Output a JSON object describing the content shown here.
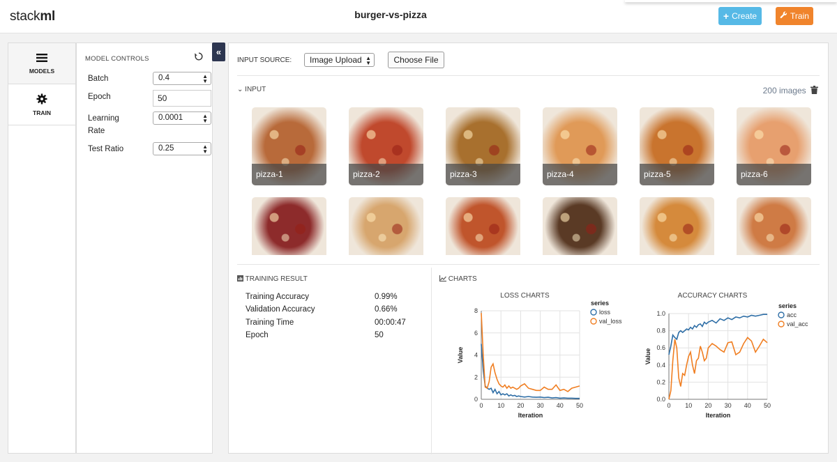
{
  "app": {
    "logo_plain": "stack",
    "logo_bold": "ml",
    "project_title": "burger-vs-pizza"
  },
  "header": {
    "create_label": "Create",
    "train_label": "Train"
  },
  "nav": {
    "items": [
      {
        "label": "MODELS"
      },
      {
        "label": "TRAIN"
      }
    ]
  },
  "controls": {
    "title": "MODEL CONTROLS",
    "batch": {
      "label": "Batch",
      "value": "0.4"
    },
    "epoch": {
      "label": "Epoch",
      "value": "50"
    },
    "learning_rate": {
      "label_1": "Learning",
      "label_2": "Rate",
      "value": "0.0001"
    },
    "test_ratio": {
      "label": "Test Ratio",
      "value": "0.25"
    }
  },
  "input": {
    "source_label": "INPUT SOURCE:",
    "source_value": "Image Upload",
    "choose_file": "Choose File",
    "section_label": "INPUT",
    "count": "200 images",
    "images": [
      {
        "caption": "pizza-1",
        "color": "#b86a3a"
      },
      {
        "caption": "pizza-2",
        "color": "#c0492d"
      },
      {
        "caption": "pizza-3",
        "color": "#a8702e"
      },
      {
        "caption": "pizza-4",
        "color": "#e09a58"
      },
      {
        "caption": "pizza-5",
        "color": "#c9742e"
      },
      {
        "caption": "pizza-6",
        "color": "#e7a06f"
      },
      {
        "caption": "",
        "color": "#8d2b2b"
      },
      {
        "caption": "",
        "color": "#d7a66e"
      },
      {
        "caption": "",
        "color": "#c0552c"
      },
      {
        "caption": "",
        "color": "#5a3a25"
      },
      {
        "caption": "",
        "color": "#d58a3c"
      },
      {
        "caption": "",
        "color": "#cf7b45"
      }
    ]
  },
  "results": {
    "title": "TRAINING RESULT",
    "rows": [
      {
        "label": "Training Accuracy",
        "value": "0.99%"
      },
      {
        "label": "Validation Accuracy",
        "value": "0.66%"
      },
      {
        "label": "Training Time",
        "value": "00:00:47"
      },
      {
        "label": "Epoch",
        "value": "50"
      }
    ]
  },
  "charts_title": "CHARTS",
  "chart_data": [
    {
      "type": "line",
      "title": "LOSS CHARTS",
      "xlabel": "Iteration",
      "ylabel": "Value",
      "xlim": [
        0,
        50
      ],
      "ylim": [
        0,
        8
      ],
      "x_ticks": [
        0,
        10,
        20,
        30,
        40,
        50
      ],
      "y_ticks": [
        0,
        2,
        4,
        6,
        8
      ],
      "grid": true,
      "legend_title": "series",
      "legend_position": "top-right",
      "series": [
        {
          "name": "loss",
          "color": "#2e6ea6",
          "x": [
            0,
            1,
            2,
            3,
            4,
            5,
            6,
            7,
            8,
            9,
            10,
            11,
            12,
            13,
            14,
            15,
            16,
            17,
            18,
            19,
            20,
            22,
            24,
            26,
            28,
            30,
            32,
            34,
            36,
            38,
            40,
            42,
            44,
            46,
            48,
            50
          ],
          "values": [
            5.0,
            2.6,
            1.2,
            1.0,
            0.9,
            1.0,
            0.6,
            0.9,
            0.5,
            0.7,
            0.4,
            0.5,
            0.4,
            0.5,
            0.3,
            0.4,
            0.3,
            0.35,
            0.25,
            0.3,
            0.25,
            0.2,
            0.25,
            0.2,
            0.18,
            0.2,
            0.15,
            0.18,
            0.12,
            0.15,
            0.1,
            0.12,
            0.1,
            0.1,
            0.08,
            0.08
          ]
        },
        {
          "name": "val_loss",
          "color": "#f07e21",
          "x": [
            0,
            1,
            2,
            3,
            4,
            5,
            6,
            7,
            8,
            9,
            10,
            11,
            12,
            13,
            14,
            15,
            16,
            17,
            18,
            19,
            20,
            22,
            24,
            26,
            28,
            30,
            32,
            34,
            36,
            38,
            40,
            42,
            44,
            46,
            48,
            50
          ],
          "values": [
            7.8,
            4.0,
            1.1,
            1.0,
            1.6,
            2.9,
            3.2,
            2.4,
            1.8,
            1.4,
            1.2,
            1.1,
            1.3,
            1.0,
            1.2,
            1.0,
            1.1,
            1.0,
            0.9,
            1.0,
            1.2,
            1.4,
            1.0,
            0.9,
            0.8,
            0.8,
            1.1,
            0.9,
            0.9,
            1.3,
            0.8,
            0.9,
            0.7,
            1.0,
            1.1,
            1.2
          ]
        }
      ]
    },
    {
      "type": "line",
      "title": "ACCURACY CHARTS",
      "xlabel": "Iteration",
      "ylabel": "Value",
      "xlim": [
        0,
        50
      ],
      "ylim": [
        0,
        1
      ],
      "x_ticks": [
        0,
        10,
        20,
        30,
        40,
        50
      ],
      "y_ticks": [
        0.0,
        0.2,
        0.4,
        0.6,
        0.8,
        1.0
      ],
      "grid": true,
      "legend_title": "series",
      "legend_position": "top-right",
      "series": [
        {
          "name": "acc",
          "color": "#2e6ea6",
          "x": [
            0,
            1,
            2,
            3,
            4,
            5,
            6,
            7,
            8,
            9,
            10,
            11,
            12,
            13,
            14,
            15,
            16,
            17,
            18,
            19,
            20,
            22,
            24,
            26,
            28,
            30,
            32,
            34,
            36,
            38,
            40,
            42,
            44,
            46,
            48,
            50
          ],
          "values": [
            0.52,
            0.62,
            0.75,
            0.72,
            0.7,
            0.78,
            0.8,
            0.78,
            0.8,
            0.82,
            0.81,
            0.84,
            0.82,
            0.86,
            0.84,
            0.87,
            0.88,
            0.85,
            0.9,
            0.88,
            0.9,
            0.92,
            0.89,
            0.94,
            0.92,
            0.95,
            0.93,
            0.96,
            0.95,
            0.97,
            0.96,
            0.98,
            0.97,
            0.98,
            0.99,
            0.99
          ]
        },
        {
          "name": "val_acc",
          "color": "#f07e21",
          "x": [
            0,
            1,
            2,
            3,
            4,
            5,
            6,
            7,
            8,
            9,
            10,
            11,
            12,
            13,
            14,
            15,
            16,
            17,
            18,
            19,
            20,
            22,
            24,
            26,
            28,
            30,
            32,
            34,
            36,
            38,
            40,
            42,
            44,
            46,
            48,
            50
          ],
          "values": [
            0.0,
            0.1,
            0.45,
            0.7,
            0.6,
            0.25,
            0.15,
            0.3,
            0.28,
            0.4,
            0.5,
            0.55,
            0.4,
            0.3,
            0.45,
            0.48,
            0.62,
            0.55,
            0.45,
            0.48,
            0.6,
            0.65,
            0.62,
            0.58,
            0.55,
            0.66,
            0.67,
            0.52,
            0.55,
            0.65,
            0.72,
            0.68,
            0.55,
            0.62,
            0.7,
            0.66
          ]
        }
      ]
    }
  ]
}
